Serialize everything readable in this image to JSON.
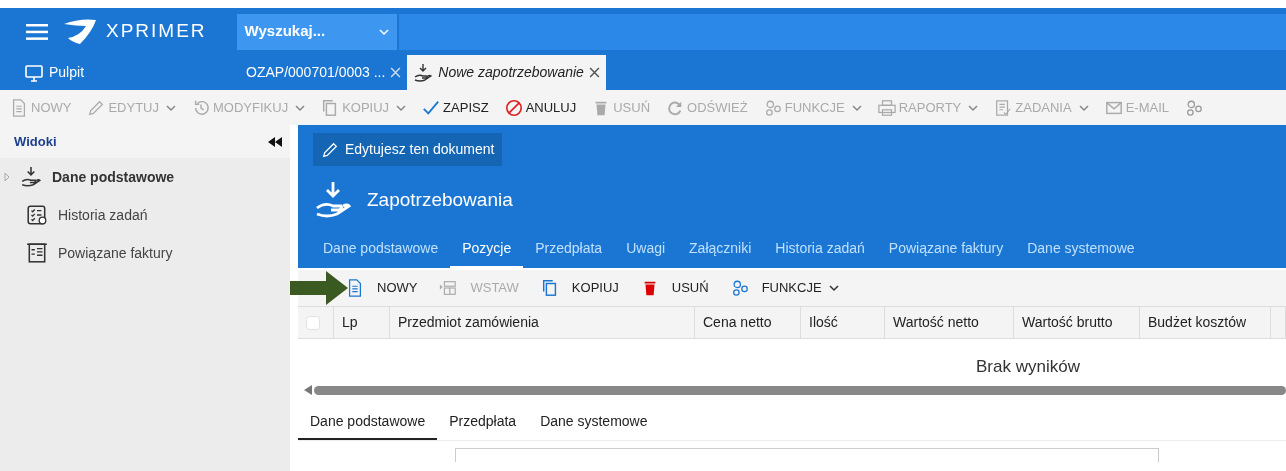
{
  "header": {
    "logo_text": "XPRIMER",
    "search": {
      "value": "Wyszukaj..."
    }
  },
  "doc_tabs": [
    {
      "label": "Pulpit",
      "kind": "monitor",
      "selected": false,
      "closable": false
    },
    {
      "label": "OZAP/000701/0003 ...",
      "kind": "plain",
      "selected": false,
      "closable": true
    },
    {
      "label": "Nowe zapotrzebowanie",
      "kind": "hand",
      "selected": true,
      "closable": true
    }
  ],
  "toolbar": [
    {
      "label": "NOWY",
      "kind": "doc",
      "disabled": true,
      "dropdown": false
    },
    {
      "label": "EDYTUJ",
      "kind": "pencil",
      "disabled": true,
      "dropdown": true
    },
    {
      "label": "MODYFIKUJ",
      "kind": "history",
      "disabled": true,
      "dropdown": true
    },
    {
      "label": "KOPIUJ",
      "kind": "copy",
      "disabled": true,
      "dropdown": true
    },
    {
      "label": "ZAPISZ",
      "kind": "check",
      "disabled": false,
      "dropdown": false
    },
    {
      "label": "ANULUJ",
      "kind": "cancel",
      "disabled": false,
      "dropdown": false
    },
    {
      "label": "USUŃ",
      "kind": "trash",
      "disabled": true,
      "dropdown": false
    },
    {
      "label": "ODŚWIEŻ",
      "kind": "refresh",
      "disabled": true,
      "dropdown": false
    },
    {
      "label": "FUNKCJE",
      "kind": "gears",
      "disabled": true,
      "dropdown": true
    },
    {
      "label": "RAPORTY",
      "kind": "printer",
      "disabled": true,
      "dropdown": true
    },
    {
      "label": "ZADANIA",
      "kind": "tasks",
      "disabled": true,
      "dropdown": true
    },
    {
      "label": "E-MAIL",
      "kind": "mail",
      "disabled": true,
      "dropdown": false
    }
  ],
  "sidebar": {
    "title": "Widoki",
    "items": [
      {
        "label": "Dane podstawowe",
        "kind": "hand",
        "selected": true
      },
      {
        "label": "Historia zadań",
        "kind": "checklist",
        "selected": false
      },
      {
        "label": "Powiązane faktury",
        "kind": "invoice",
        "selected": false
      }
    ]
  },
  "document": {
    "banner": "Edytujesz ten dokument",
    "title": "Zapotrzebowania",
    "tabs": [
      {
        "label": "Dane podstawowe",
        "selected": false
      },
      {
        "label": "Pozycje",
        "selected": true
      },
      {
        "label": "Przedpłata",
        "selected": false
      },
      {
        "label": "Uwagi",
        "selected": false
      },
      {
        "label": "Załączniki",
        "selected": false
      },
      {
        "label": "Historia zadań",
        "selected": false
      },
      {
        "label": "Powiązane faktury",
        "selected": false
      },
      {
        "label": "Dane systemowe",
        "selected": false
      }
    ],
    "toolbar": [
      {
        "label": "NOWY",
        "kind": "doc",
        "disabled": false,
        "dropdown": false
      },
      {
        "label": "WSTAW",
        "kind": "insert",
        "disabled": true,
        "dropdown": false
      },
      {
        "label": "KOPIUJ",
        "kind": "copy",
        "disabled": false,
        "dropdown": false
      },
      {
        "label": "USUŃ",
        "kind": "trash",
        "disabled": false,
        "dropdown": false
      },
      {
        "label": "FUNKCJE",
        "kind": "gears",
        "disabled": false,
        "dropdown": true
      }
    ],
    "table": {
      "select_all_checked": false,
      "columns": [
        "Lp",
        "Przedmiot zamówienia",
        "Cena netto",
        "Ilość",
        "Wartość netto",
        "Wartość brutto",
        "Budżet kosztów"
      ],
      "empty_message": "Brak wyników"
    },
    "bottom_tabs": [
      {
        "label": "Dane podstawowe",
        "selected": true
      },
      {
        "label": "Przedpłata",
        "selected": false
      },
      {
        "label": "Dane systemowe",
        "selected": false
      }
    ]
  }
}
